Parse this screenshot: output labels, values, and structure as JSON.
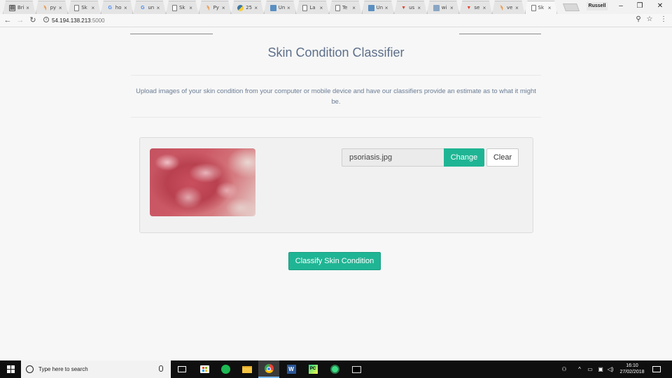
{
  "browser": {
    "tabs": [
      {
        "title": "Bri",
        "icon": "book-icon"
      },
      {
        "title": "py",
        "icon": "firefox-icon"
      },
      {
        "title": "Sk",
        "icon": "doc-icon"
      },
      {
        "title": "ho",
        "icon": "google-icon"
      },
      {
        "title": "un",
        "icon": "google-icon"
      },
      {
        "title": "Sk",
        "icon": "doc-icon"
      },
      {
        "title": "Py",
        "icon": "firefox-icon"
      },
      {
        "title": "25",
        "icon": "python-icon"
      },
      {
        "title": "Un",
        "icon": "image-icon"
      },
      {
        "title": "La",
        "icon": "doc-icon"
      },
      {
        "title": "Te",
        "icon": "doc-icon"
      },
      {
        "title": "Un",
        "icon": "image-icon"
      },
      {
        "title": "us",
        "icon": "gitlab-icon"
      },
      {
        "title": "wi",
        "icon": "wordnet-icon"
      },
      {
        "title": "se",
        "icon": "gitlab-icon"
      },
      {
        "title": "ve",
        "icon": "firefox-icon"
      },
      {
        "title": "Sk",
        "icon": "doc-icon",
        "active": true
      }
    ],
    "tab_close_glyph": "×",
    "profile_name": "Russell",
    "window_controls": {
      "minimize": "–",
      "restore": "❐",
      "close": "✕"
    },
    "url_host": "54.194.138.213",
    "url_port": ":5000"
  },
  "page": {
    "title": "Skin Condition Classifier",
    "intro": "Upload images of your skin condition from your computer or mobile device and have our classifiers provide an estimate as to what it might be.",
    "upload": {
      "filename": "psoriasis.jpg",
      "change_label": "Change",
      "clear_label": "Clear"
    },
    "classify_label": "Classify Skin Condition"
  },
  "taskbar": {
    "search_placeholder": "Type here to search",
    "time": "16:10",
    "date": "27/02/2018"
  },
  "colors": {
    "accent": "#1fb594",
    "title_text": "#5d6f8a"
  }
}
